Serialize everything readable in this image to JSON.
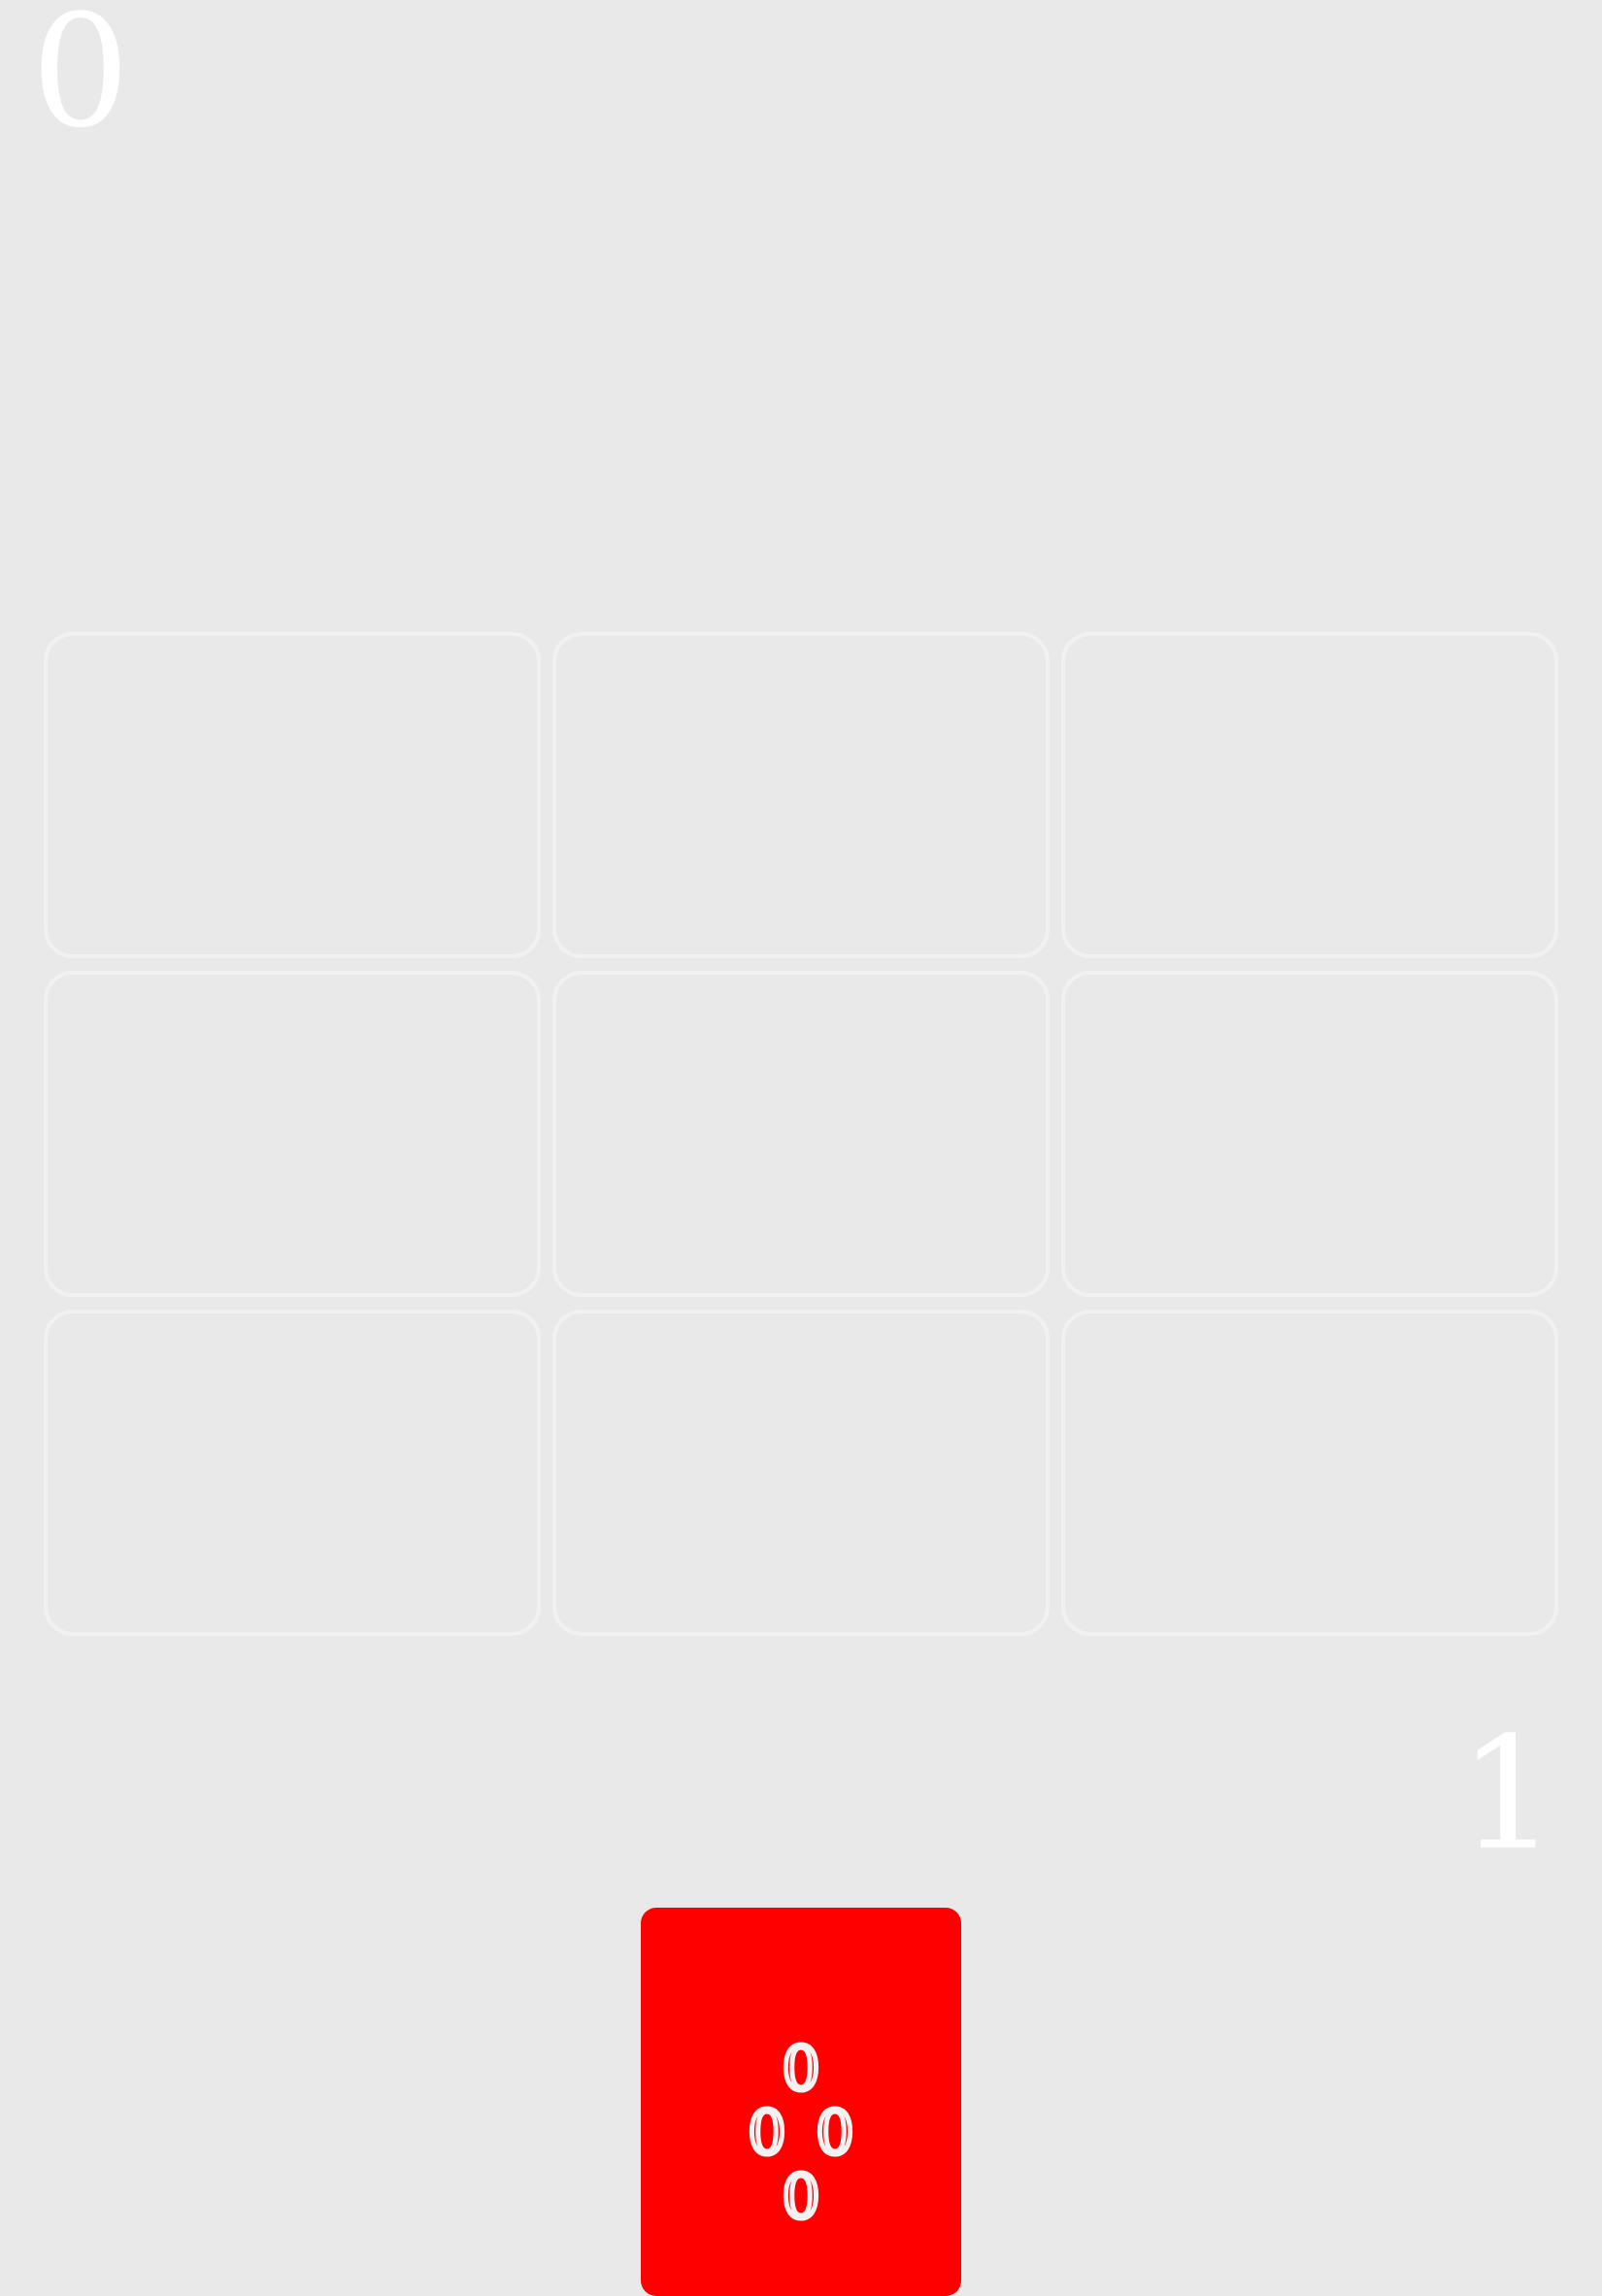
{
  "scores": {
    "opponent": "0",
    "player": "1"
  },
  "board": {
    "rows": 3,
    "columns": 3,
    "slots": [
      {
        "label": ""
      },
      {
        "label": ""
      },
      {
        "label": ""
      },
      {
        "label": ""
      },
      {
        "label": ""
      },
      {
        "label": ""
      },
      {
        "label": ""
      },
      {
        "label": ""
      },
      {
        "label": ""
      }
    ]
  },
  "hand": {
    "card": {
      "color": "#ff0000",
      "emblem_symbol": "0",
      "emblem_icon": "diamond-of-zeros-icon"
    }
  },
  "colors": {
    "background": "#e9e9e9",
    "slot_border": "#f1f1f1",
    "score_text": "#ffffff"
  }
}
